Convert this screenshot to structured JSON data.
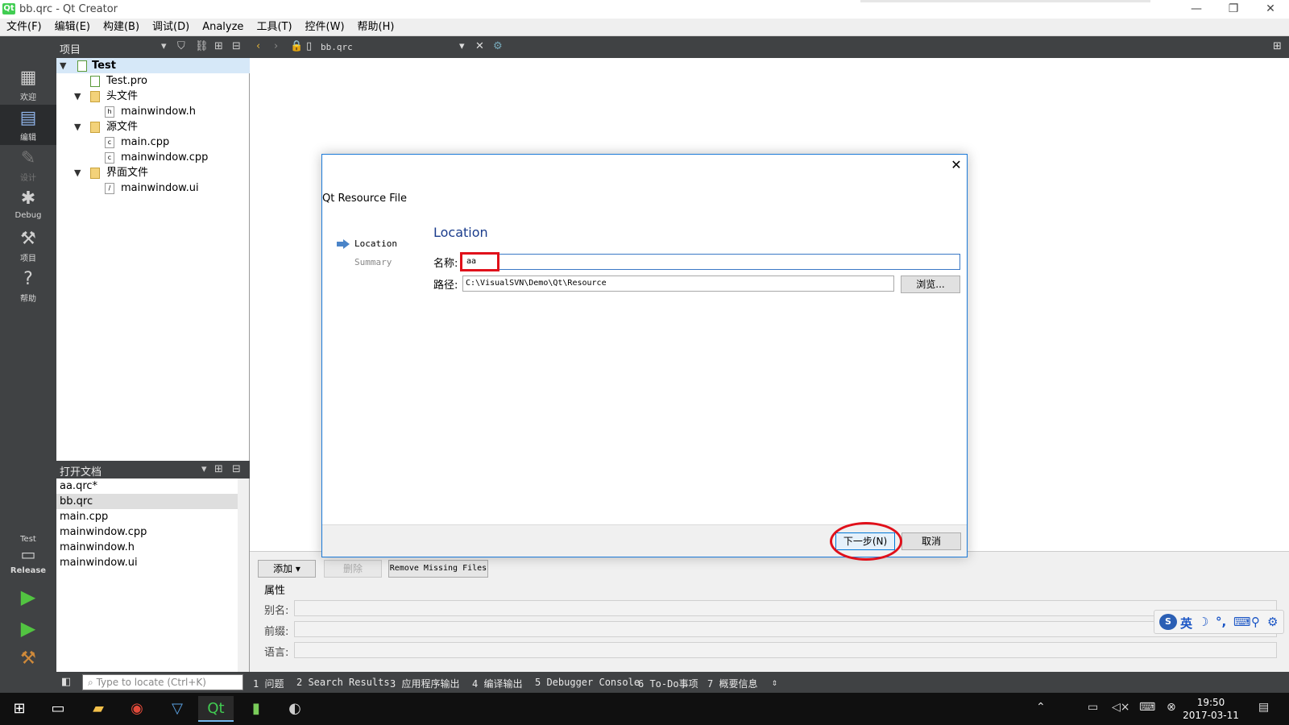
{
  "window": {
    "title": "bb.qrc - Qt Creator",
    "icon": "Qt"
  },
  "menu": [
    "文件(F)",
    "编辑(E)",
    "构建(B)",
    "调试(D)",
    "Analyze",
    "工具(T)",
    "控件(W)",
    "帮助(H)"
  ],
  "modes": [
    {
      "label": "欢迎",
      "icon": "grid-icon"
    },
    {
      "label": "编辑",
      "icon": "edit-document-icon"
    },
    {
      "label": "设计",
      "icon": "pencil-icon"
    },
    {
      "label": "Debug",
      "icon": "bug-icon"
    },
    {
      "label": "项目",
      "icon": "wrench-icon"
    },
    {
      "label": "帮助",
      "icon": "help-icon"
    }
  ],
  "kit": {
    "project": "Test",
    "config": "Release"
  },
  "projects_panel": {
    "title": "项目"
  },
  "editor_toolbar": {
    "file": "bb.qrc"
  },
  "tree": [
    {
      "label": "Test",
      "level": 0,
      "expanded": true,
      "selected": true
    },
    {
      "label": "Test.pro",
      "level": 1
    },
    {
      "label": "头文件",
      "level": 1,
      "expanded": true
    },
    {
      "label": "mainwindow.h",
      "level": 2
    },
    {
      "label": "源文件",
      "level": 1,
      "expanded": true
    },
    {
      "label": "main.cpp",
      "level": 2
    },
    {
      "label": "mainwindow.cpp",
      "level": 2
    },
    {
      "label": "界面文件",
      "level": 1,
      "expanded": true
    },
    {
      "label": "mainwindow.ui",
      "level": 2
    }
  ],
  "open_docs": {
    "title": "打开文档",
    "items": [
      "aa.qrc*",
      "bb.qrc",
      "main.cpp",
      "mainwindow.cpp",
      "mainwindow.h",
      "mainwindow.ui"
    ],
    "selected": 1
  },
  "locator": {
    "placeholder": "Type to locate (Ctrl+K)"
  },
  "output_tabs": [
    "1 问题",
    "2 Search Results",
    "3 应用程序输出",
    "4 编译输出",
    "5 Debugger Console",
    "6 To-Do事项",
    "7 概要信息"
  ],
  "resource_editor": {
    "add": "添加",
    "remove": "删除",
    "remove_missing": "Remove Missing Files",
    "properties": "属性",
    "alias": "别名:",
    "prefix": "前缀:",
    "language": "语言:"
  },
  "dialog": {
    "title": "Qt Resource File",
    "steps": [
      "Location",
      "Summary"
    ],
    "heading": "Location",
    "name_label": "名称:",
    "name_value": "aa",
    "path_label": "路径:",
    "path_value": "C:\\VisualSVN\\Demo\\Qt\\Resource",
    "browse": "浏览...",
    "next": "下一步(N)",
    "cancel": "取消"
  },
  "ime": {
    "lang": "英"
  },
  "clock": {
    "time": "19:50",
    "date": "2017-03-11"
  },
  "colors": {
    "accent": "#1c7ad8",
    "sidebar": "#404244",
    "annotation": "#e0101a"
  }
}
